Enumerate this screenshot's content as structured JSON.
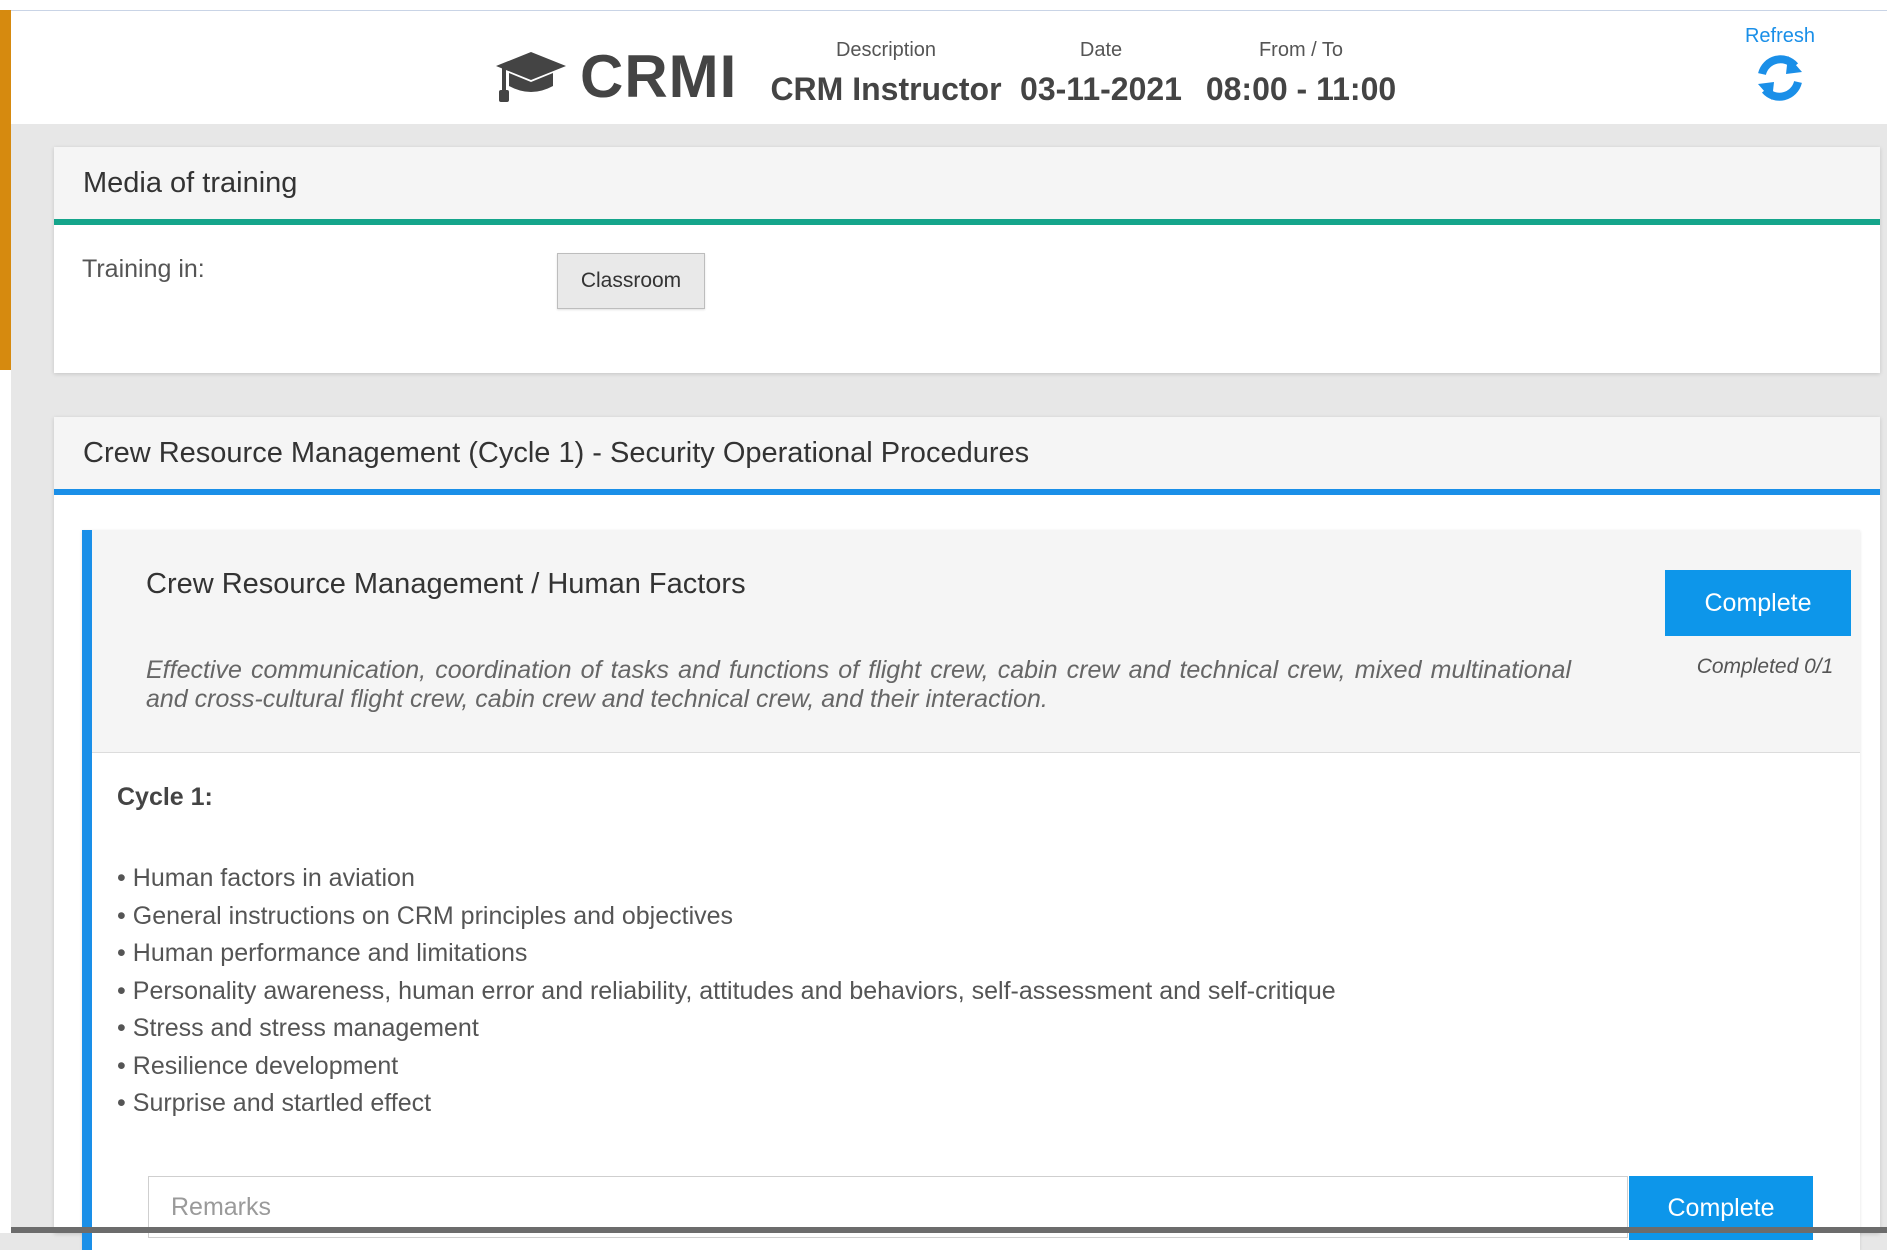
{
  "header": {
    "logo_text": "CRMI",
    "description_label": "Description",
    "description_value": "CRM Instructor",
    "date_label": "Date",
    "date_value": "03-11-2021",
    "time_label": "From / To",
    "time_value": "08:00 - 11:00",
    "refresh_label": "Refresh",
    "logo_icon": "graduation-cap-icon",
    "refresh_icon": "refresh-icon"
  },
  "media_panel": {
    "title": "Media of training",
    "training_label": "Training in:",
    "training_value": "Classroom"
  },
  "course_panel": {
    "title": "Crew Resource Management (Cycle 1) - Security Operational Procedures",
    "module": {
      "title": "Crew Resource Management / Human Factors",
      "description": "Effective communication, coordination of tasks and functions of flight crew, cabin crew and technical crew, mixed multinational and cross-cultural flight crew, cabin crew and technical crew, and their interaction.",
      "complete_label": "Complete",
      "completed_status": "Completed 0/1",
      "cycle_heading": "Cycle 1:",
      "topics": [
        "Human factors in aviation",
        "General instructions on CRM principles and objectives",
        "Human performance and limitations",
        "Personality awareness, human error and reliability, attitudes and behaviors, self-assessment and self-critique",
        "Stress and stress management",
        "Resilience development",
        "Surprise and startled effect"
      ],
      "remarks_placeholder": "Remarks",
      "remarks_complete_label": "Complete"
    }
  },
  "colors": {
    "accent_blue": "#0d96ea",
    "green_bar": "#14a58b",
    "orange_stripe": "#d68a0f"
  }
}
